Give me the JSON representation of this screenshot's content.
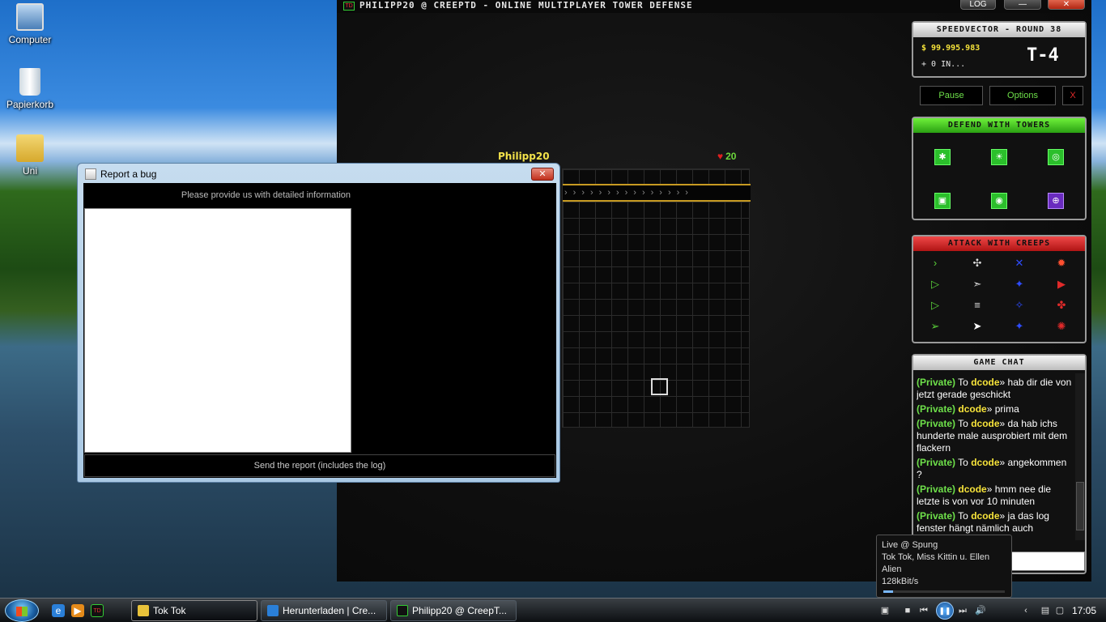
{
  "desktop": {
    "icons": [
      {
        "label": "Computer",
        "icon": "computer-icon"
      },
      {
        "label": "Papierkorb",
        "icon": "recycle-bin-icon"
      },
      {
        "label": "Uni",
        "icon": "folder-shortcut-icon"
      }
    ]
  },
  "game": {
    "title": "PHILIPP20 @ CREEPTD - ONLINE MULTIPLAYER TOWER DEFENSE",
    "log_label": "LOG",
    "player": "Philipp20",
    "lives": "20",
    "status": {
      "header": "SPEEDVECTOR - ROUND 38",
      "money": "$ 99.995.983",
      "income": "+ 0 IN...",
      "timer": "T-4"
    },
    "controls": {
      "pause": "Pause",
      "options": "Options",
      "close": "X"
    },
    "towers_header": "DEFEND WITH TOWERS",
    "creeps_header": "ATTACK WITH CREEPS",
    "chat": {
      "header": "GAME CHAT",
      "messages": [
        {
          "tag": "(Private)",
          "pre": "To",
          "nick": "dcode",
          "text": "hab dir die von jetzt gerade geschickt"
        },
        {
          "tag": "(Private)",
          "pre": "",
          "nick": "dcode",
          "text": "prima"
        },
        {
          "tag": "(Private)",
          "pre": "To",
          "nick": "dcode",
          "text": "da hab ichs hunderte male ausprobiert mit dem flackern"
        },
        {
          "tag": "(Private)",
          "pre": "To",
          "nick": "dcode",
          "text": "angekommen ?"
        },
        {
          "tag": "(Private)",
          "pre": "",
          "nick": "dcode",
          "text": "hmm nee die letzte is von vor 10 minuten"
        },
        {
          "tag": "(Private)",
          "pre": "To",
          "nick": "dcode",
          "text": "ja das log fenster hängt nämlich auch"
        }
      ]
    }
  },
  "bug_dialog": {
    "title": "Report a bug",
    "info": "Please provide us with detailed information",
    "send": "Send the report (includes the log)"
  },
  "media": {
    "station": "Live @ Spung",
    "track": "Tok Tok, Miss Kittin u. Ellen Alien",
    "bitrate": "128kBit/s",
    "progress": 0.08
  },
  "taskbar": {
    "tasks": [
      {
        "label": "Tok Tok",
        "icon": "winamp-icon"
      },
      {
        "label": "Herunterladen | Cre...",
        "icon": "internet-explorer-icon"
      },
      {
        "label": "Philipp20 @ CreepT...",
        "icon": "creeptd-icon"
      }
    ],
    "clock": "17:05"
  },
  "colors": {
    "accent_green": "#6ee04a",
    "accent_yellow": "#f6e33a",
    "accent_red": "#e02a2a"
  }
}
